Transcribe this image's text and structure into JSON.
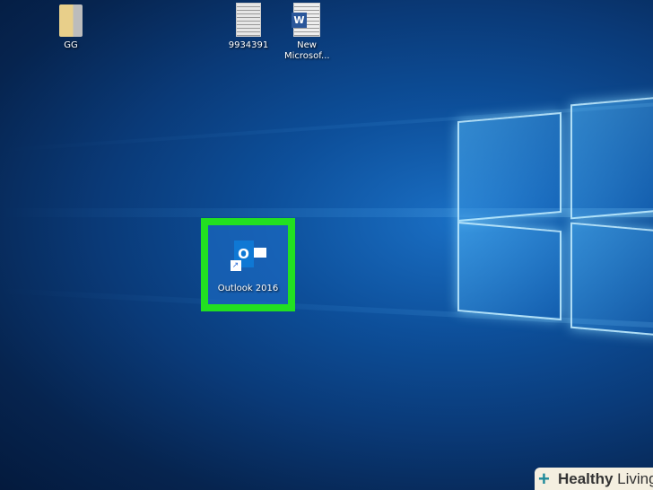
{
  "desktop": {
    "icons": [
      {
        "label": "GG",
        "type": "folder-icon"
      },
      {
        "label": "9934391",
        "type": "text-file-icon"
      },
      {
        "label": "New Microsof...",
        "type": "word-document-icon"
      },
      {
        "label": "Outlook 2016",
        "type": "outlook-shortcut-icon",
        "highlighted": true
      }
    ]
  },
  "colors": {
    "highlight": "#22e021",
    "wallpaper": "#0d4f9a"
  },
  "watermark": {
    "brand_bold": "Healthy",
    "brand_light": "Living"
  }
}
